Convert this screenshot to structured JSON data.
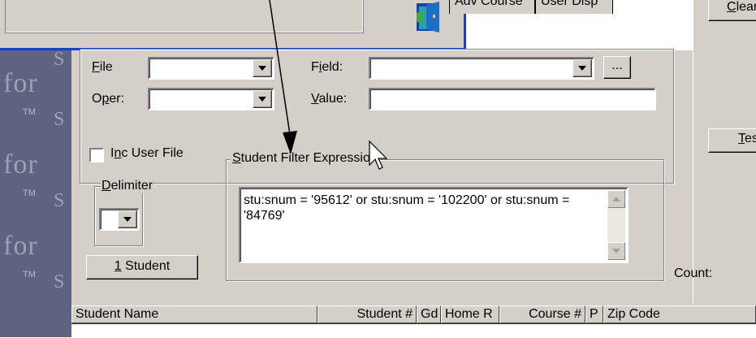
{
  "popup": {
    "icon": "exit-door-icon"
  },
  "sidebar": {
    "watermark_text": "for",
    "tm_text": "TM",
    "s_text": "S"
  },
  "tabs": [
    {
      "label": "Adv Course"
    },
    {
      "label": "User Disp"
    }
  ],
  "right_panel": {
    "clear_label": "Clear",
    "test_label": "Tes",
    "count_label": "Count:"
  },
  "form": {
    "file_label": "File",
    "file_value": "",
    "oper_label": "Oper:",
    "oper_value": "",
    "field_label": "Field:",
    "field_value": "",
    "value_label": "Value:",
    "value_value": "",
    "browse_label": "...",
    "inc_user_file_label": "Inc User File",
    "inc_user_file_checked": false,
    "delimiter_label": "Delimiter",
    "delimiter_value": "",
    "one_student_label": "1 Student"
  },
  "filter": {
    "group_label": "Student Filter Expression",
    "expression": "stu:snum = '95612' or stu:snum = '102200' or stu:snum = '84769'"
  },
  "grid": {
    "columns": [
      "Student Name",
      "Student #",
      "Gd",
      "Home R",
      "Course #",
      "P",
      "Zip Code"
    ]
  },
  "colors": {
    "dialog_face": "#d4d0c8",
    "popup_border": "#1c3cd0",
    "sidebar_bg": "#5e6380"
  }
}
